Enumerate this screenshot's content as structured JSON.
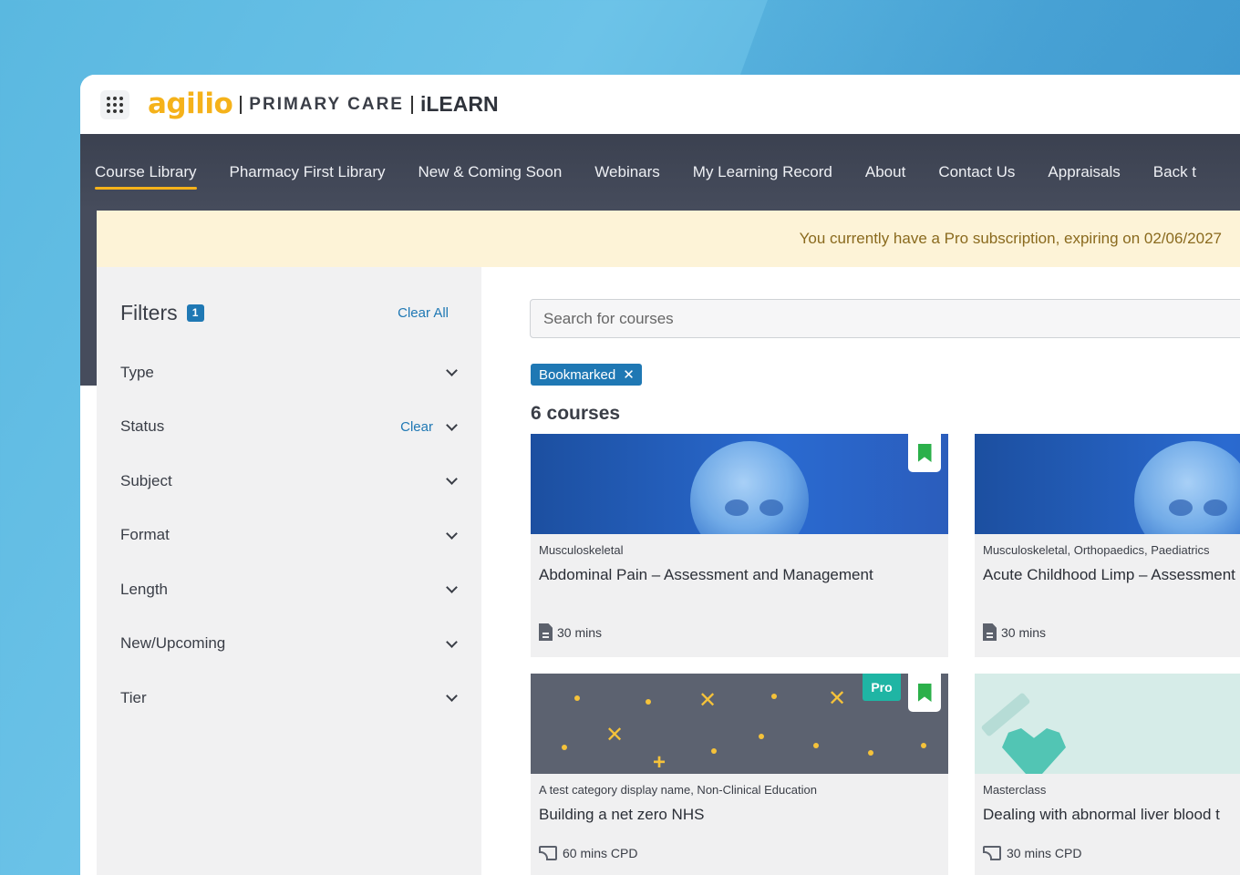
{
  "header": {
    "logo_brand": "agilio",
    "logo_product": "PRIMARY CARE",
    "logo_app": "iLEARN"
  },
  "nav": {
    "items": [
      {
        "label": "Course Library",
        "active": true
      },
      {
        "label": "Pharmacy First Library"
      },
      {
        "label": "New & Coming Soon"
      },
      {
        "label": "Webinars"
      },
      {
        "label": "My Learning Record"
      },
      {
        "label": "About"
      },
      {
        "label": "Contact Us"
      },
      {
        "label": "Appraisals"
      },
      {
        "label": "Back t"
      }
    ]
  },
  "banner": {
    "text": "You currently have a Pro subscription, expiring on 02/06/2027"
  },
  "filters": {
    "title": "Filters",
    "count": "1",
    "clear_all": "Clear All",
    "items": [
      {
        "label": "Type"
      },
      {
        "label": "Status",
        "clear": "Clear"
      },
      {
        "label": "Subject"
      },
      {
        "label": "Format"
      },
      {
        "label": "Length"
      },
      {
        "label": "New/Upcoming"
      },
      {
        "label": "Tier"
      }
    ]
  },
  "search": {
    "placeholder": "Search for courses"
  },
  "active_filter": {
    "label": "Bookmarked",
    "remove": "✕"
  },
  "results": {
    "count_label": "6 courses"
  },
  "cards": [
    {
      "category": "Musculoskeletal",
      "title": "Abdominal Pain – Assessment and Management",
      "meta": "30 mins",
      "meta_icon": "document-icon",
      "bookmarked": true
    },
    {
      "category": "Musculoskeletal, Orthopaedics, Paediatrics",
      "title": "Acute Childhood Limp – Assessment and Management",
      "meta": "30 mins",
      "meta_icon": "document-icon",
      "bookmarked": false
    },
    {
      "category": "A test category display name, Non-Clinical Education",
      "title": "Building a net zero NHS",
      "meta": "60 mins CPD",
      "meta_icon": "cast-icon",
      "badge": "Pro",
      "bookmarked": true
    },
    {
      "category": "Masterclass",
      "title": "Dealing with abnormal liver blood t",
      "meta": "30 mins CPD",
      "meta_icon": "cast-icon",
      "bookmarked": false
    }
  ],
  "colors": {
    "accent_yellow": "#f5b21a",
    "nav_bg": "#464c5c",
    "link_blue": "#1f78b4",
    "bookmark_green": "#2bb04a",
    "pro_teal": "#1fb5a4",
    "banner_bg": "#fdf3d7"
  }
}
